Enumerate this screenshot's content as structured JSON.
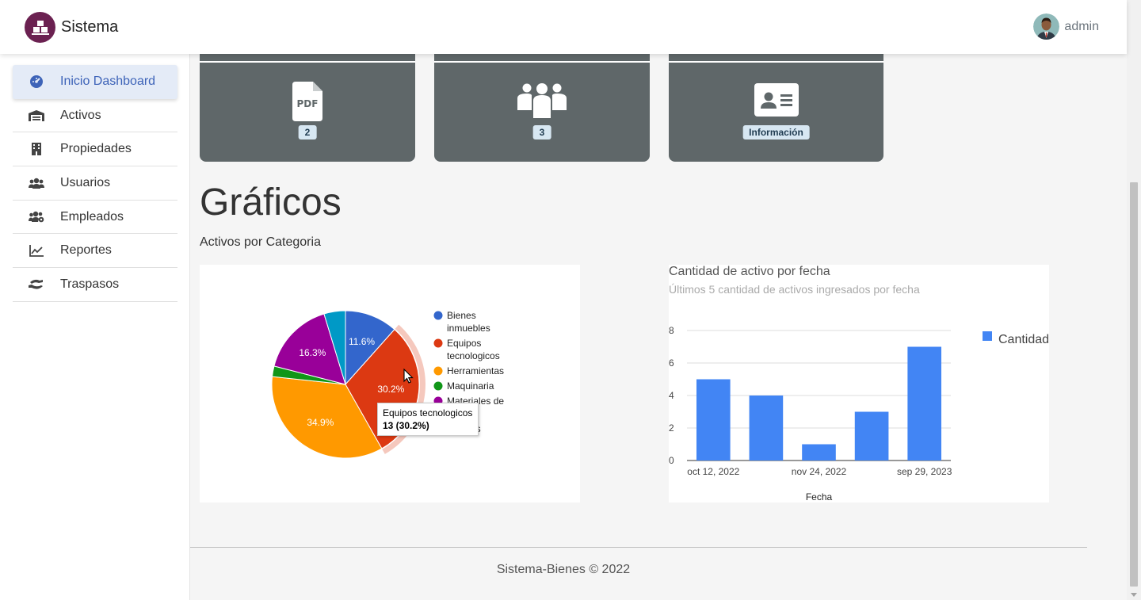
{
  "app": {
    "brand": "Sistema",
    "user": "admin"
  },
  "sidebar": {
    "items": [
      {
        "label": "Inicio Dashboard",
        "icon": "dashboard-icon"
      },
      {
        "label": "Activos",
        "icon": "warehouse-icon"
      },
      {
        "label": "Propiedades",
        "icon": "building-icon"
      },
      {
        "label": "Usuarios",
        "icon": "users-icon"
      },
      {
        "label": "Empleados",
        "icon": "users-cog-icon"
      },
      {
        "label": "Reportes",
        "icon": "chart-line-icon"
      },
      {
        "label": "Traspasos",
        "icon": "hand-holding-icon"
      }
    ]
  },
  "cards": [
    {
      "icon": "pdf-file-icon",
      "badge": "2"
    },
    {
      "icon": "users-group-icon",
      "badge": "3"
    },
    {
      "icon": "id-card-icon",
      "badge": "Información"
    }
  ],
  "section": {
    "title": "Gráficos",
    "subtitle": "Activos por Categoria"
  },
  "colors": {
    "card": "#5f6769",
    "accent": "#3d63b8",
    "brand": "#6b2151"
  },
  "chart_data": [
    {
      "type": "pie",
      "slices": [
        {
          "label": "Bienes inmuebles",
          "percent": 11.6,
          "color": "#3366cc"
        },
        {
          "label": "Equipos tecnologicos",
          "percent": 30.2,
          "value": 13,
          "color": "#dc3912"
        },
        {
          "label": "Herramientas",
          "percent": 34.9,
          "color": "#ff9900"
        },
        {
          "label": "Maquinaria",
          "percent": 2.3,
          "color": "#109618"
        },
        {
          "label": "Materiales de",
          "percent": 16.3,
          "color": "#990099"
        },
        {
          "label": "os",
          "percent": 4.7,
          "color": "#0099c6"
        }
      ],
      "highlighted": "Equipos tecnologicos",
      "tooltip": {
        "title": "Equipos tecnologicos",
        "value": "13 (30.2%)"
      },
      "legend_position": "right"
    },
    {
      "type": "bar",
      "title": "Cantidad de activo por fecha",
      "subtitle": "Últimos 5 cantidad de activos ingresados por fecha",
      "xlabel": "Fecha",
      "ylabel": "",
      "series": [
        {
          "name": "Cantidad",
          "values": [
            5,
            4,
            1,
            3,
            7
          ],
          "color": "#4285f4"
        }
      ],
      "tick_labels_x": [
        "oct 12, 2022",
        "nov 24, 2022",
        "sep 29, 2023"
      ],
      "tick_label_positions": [
        0,
        2,
        4
      ],
      "ylim": [
        0,
        8
      ],
      "yticks": [
        0,
        2,
        4,
        6,
        8
      ],
      "grid": true,
      "legend_position": "right"
    }
  ],
  "footer": "Sistema-Bienes © 2022"
}
